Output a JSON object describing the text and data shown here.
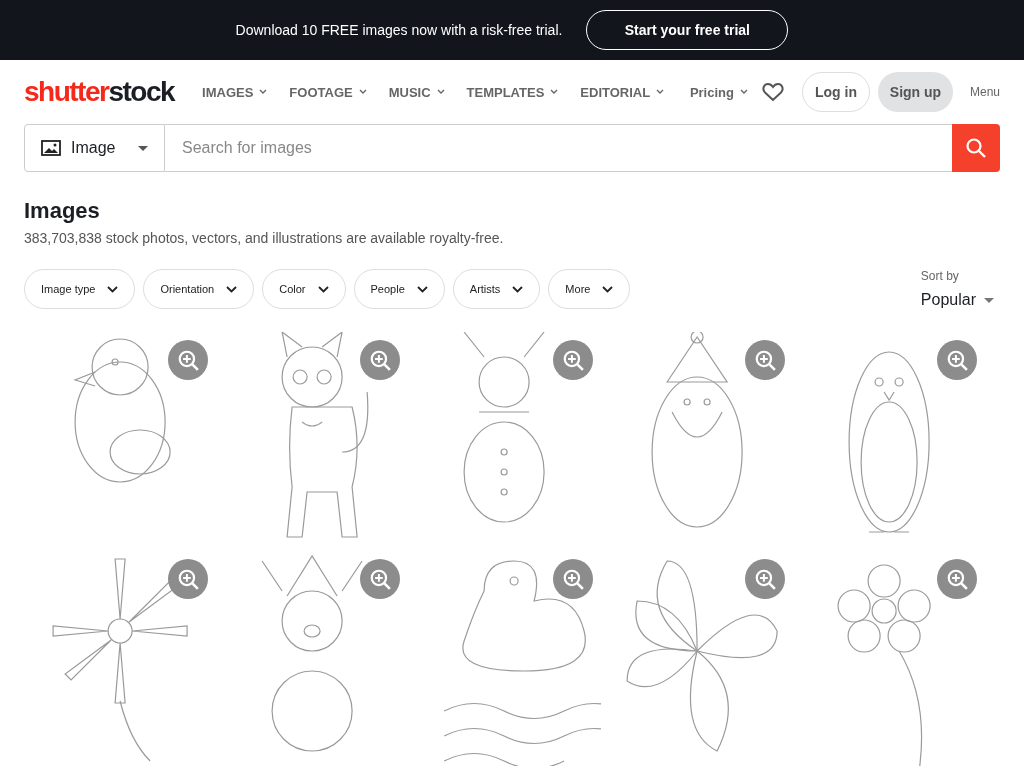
{
  "promo_bar": {
    "message": "Download 10 FREE images now with a risk-free trial.",
    "button": "Start your free trial"
  },
  "header": {
    "logo": [
      {
        "text": "shutter",
        "color": "#f5291b"
      },
      {
        "text": "stock",
        "color": "#1b1e24"
      }
    ],
    "nav": [
      {
        "label": "IMAGES",
        "kind": "dropdown"
      },
      {
        "label": "FOOTAGE",
        "kind": "dropdown"
      },
      {
        "label": "MUSIC",
        "kind": "dropdown"
      },
      {
        "label": "TEMPLATES",
        "kind": "dropdown"
      },
      {
        "label": "EDITORIAL",
        "kind": "dropdown"
      }
    ],
    "pricing": "Pricing",
    "login": "Log in",
    "signup": "Sign up",
    "menu": "Menu"
  },
  "search": {
    "type": "Image",
    "placeholder": "Search for images"
  },
  "heading": {
    "title": "Images",
    "subtitle": "383,703,838 stock photos, vectors, and illustrations are available royalty-free."
  },
  "filters": [
    "Image type",
    "Orientation",
    "Color",
    "People",
    "Artists",
    "More"
  ],
  "sort": {
    "label": "Sort by",
    "value": "Popular"
  }
}
